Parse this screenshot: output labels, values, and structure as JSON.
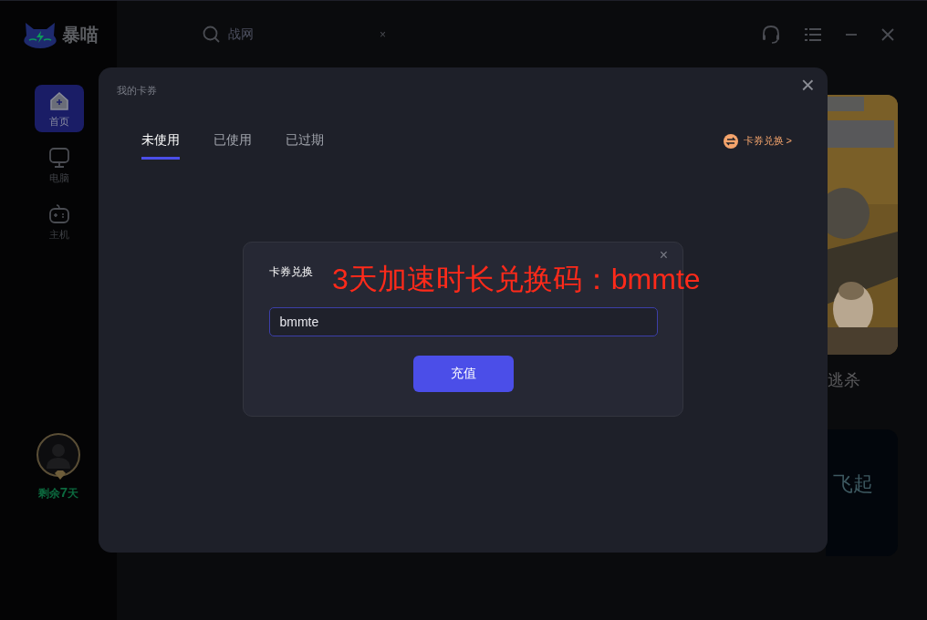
{
  "app": {
    "logo_text": "暴喵"
  },
  "search": {
    "value": "战网",
    "clear": "×"
  },
  "sidebar": {
    "items": [
      {
        "label": "首页",
        "selected": true
      },
      {
        "label": "电脑",
        "selected": false
      },
      {
        "label": "主机",
        "selected": false
      }
    ],
    "remaining": "剩余**7**天"
  },
  "background_cards": [
    {
      "kind": "poster",
      "caption": "逃杀"
    },
    {
      "kind": "banner",
      "caption": "飞起"
    }
  ],
  "modal": {
    "title": "我的卡券",
    "close": "×",
    "tabs": [
      {
        "label": "未使用",
        "selected": true
      },
      {
        "label": "已使用",
        "selected": false
      },
      {
        "label": "已过期",
        "selected": false
      }
    ],
    "redeem_link": "卡券兑换 >",
    "dialog": {
      "title": "卡券兑换",
      "input_value": "bmmte",
      "button": "充值"
    }
  },
  "annotation": "3天加速时长兑换码：bmmte"
}
